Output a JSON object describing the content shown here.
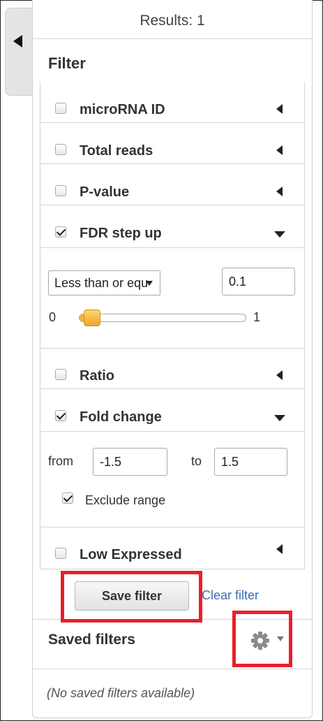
{
  "panel": {
    "results_text": "Results: 1",
    "filter_title": "Filter"
  },
  "filters": [
    {
      "label": "microRNA ID",
      "checked": false,
      "expanded": false
    },
    {
      "label": "Total reads",
      "checked": false,
      "expanded": false
    },
    {
      "label": "P-value",
      "checked": false,
      "expanded": false
    },
    {
      "label": "FDR step up",
      "checked": true,
      "expanded": true
    },
    {
      "label": "Ratio",
      "checked": false,
      "expanded": false
    },
    {
      "label": "Fold change",
      "checked": true,
      "expanded": true
    },
    {
      "label": "Low Expressed",
      "checked": false,
      "expanded": false
    }
  ],
  "fdr": {
    "operator": "Less than or equ",
    "value": "0.1",
    "slider_min": "0",
    "slider_max": "1",
    "slider_value": 0.1
  },
  "fold_change": {
    "from_label": "from",
    "from_value": "-1.5",
    "to_label": "to",
    "to_value": "1.5",
    "exclude_label": "Exclude range",
    "exclude_checked": true
  },
  "actions": {
    "save_label": "Save filter",
    "clear_label": "Clear filter"
  },
  "saved_filters": {
    "title": "Saved filters",
    "empty_message": "(No saved filters available)"
  },
  "colors": {
    "highlight": "#e8202a",
    "slider_accent": "#f2b23c",
    "link": "#3a6fb5"
  }
}
